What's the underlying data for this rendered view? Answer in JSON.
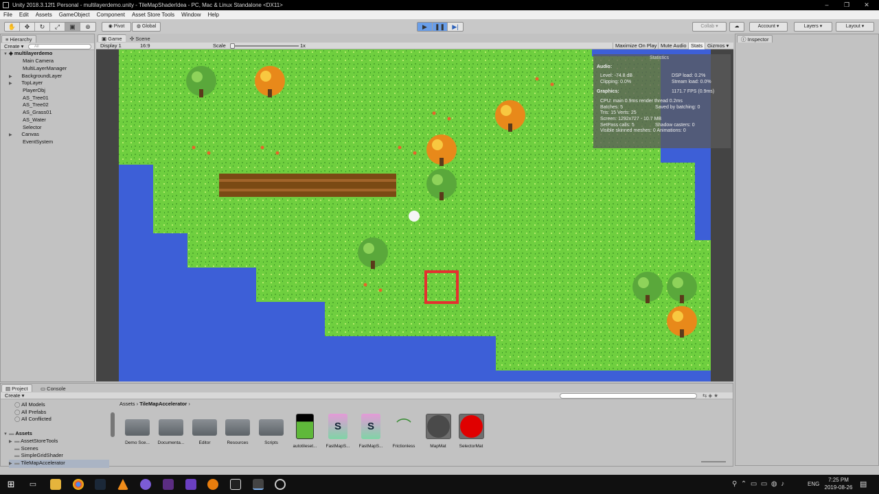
{
  "window": {
    "title": "Unity 2018.3.12f1 Personal - multilayerdemo.unity - TileMapShaderIdea - PC, Mac & Linux Standalone <DX11>",
    "minimize": "–",
    "maximize": "❐",
    "close": "✕"
  },
  "menu": [
    "File",
    "Edit",
    "Assets",
    "GameObject",
    "Component",
    "Asset Store Tools",
    "Window",
    "Help"
  ],
  "toolbar": {
    "pivot": "Pivot",
    "global": "Global",
    "collab": "Collab ▾",
    "account": "Account",
    "layers": "Layers",
    "layout": "Layout"
  },
  "hierarchy": {
    "tab": "Hierarchy",
    "create": "Create ▾",
    "search_placeholder": "All",
    "scene": "multilayerdemo",
    "items": [
      "Main Camera",
      "MultiLayerManager",
      "BackgroundLayer",
      "TopLayer",
      "PlayerObj",
      "AS_Tree01",
      "AS_Tree02",
      "AS_Grass01",
      "AS_Water",
      "Selector",
      "Canvas",
      "EventSystem"
    ]
  },
  "game": {
    "tab_game": "Game",
    "tab_scene": "Scene",
    "display": "Display 1",
    "aspect": "16:9",
    "scale_label": "Scale",
    "scale_value": "1x",
    "maximize": "Maximize On Play",
    "mute": "Mute Audio",
    "stats": "Stats",
    "gizmos": "Gizmos"
  },
  "statistics": {
    "title": "Statistics",
    "audio": "Audio:",
    "level": "Level: -74.8 dB",
    "clipping": "Clipping: 0.0%",
    "dsp": "DSP load: 0.2%",
    "stream": "Stream load: 0.0%",
    "graphics": "Graphics:",
    "fps": "1171.7 FPS (0.9ms)",
    "cpu": "CPU: main 0.9ms  render thread 0.2ms",
    "batches": "Batches: 5",
    "saved": "Saved by batching: 0",
    "tris": "Tris: 15   Verts: 25",
    "screen": "Screen: 1292x727 - 10.7 MB",
    "setpass": "SetPass calls: 5",
    "shadow": "Shadow casters: 0",
    "skinned": "Visible skinned meshes: 0  Animations: 0"
  },
  "inspector": {
    "tab": "Inspector"
  },
  "project": {
    "tab_project": "Project",
    "tab_console": "Console",
    "create": "Create ▾",
    "favorites": [
      "All Models",
      "All Prefabs",
      "All Conflicted"
    ],
    "assets_root": "Assets",
    "folders": [
      "AssetStoreTools",
      "Scenes",
      "SimpleGridShader",
      "TileMapAccelerator"
    ],
    "breadcrumb": [
      "Assets",
      "TileMapAccelerator"
    ],
    "assets": [
      {
        "label": "Demo Sce...",
        "kind": "folder"
      },
      {
        "label": "Documenta...",
        "kind": "folder"
      },
      {
        "label": "Editor",
        "kind": "folder"
      },
      {
        "label": "Resources",
        "kind": "folder"
      },
      {
        "label": "Scripts",
        "kind": "folder"
      },
      {
        "label": "autotileset...",
        "kind": "texture"
      },
      {
        "label": "FastMapS...",
        "kind": "shader"
      },
      {
        "label": "FastMapS...",
        "kind": "shader"
      },
      {
        "label": "Frictionless",
        "kind": "physics"
      },
      {
        "label": "MapMat",
        "kind": "material-gray"
      },
      {
        "label": "SelectorMat",
        "kind": "material-red"
      }
    ]
  },
  "taskbar": {
    "lang": "ENG",
    "time": "7:25 PM",
    "date": "2019-08-26"
  },
  "colors": {
    "grass": "#6fcf3f",
    "water": "#3d5fd7",
    "fence": "#7a4a14",
    "selector": "#e53030",
    "play_active": "#6a9ee8"
  }
}
